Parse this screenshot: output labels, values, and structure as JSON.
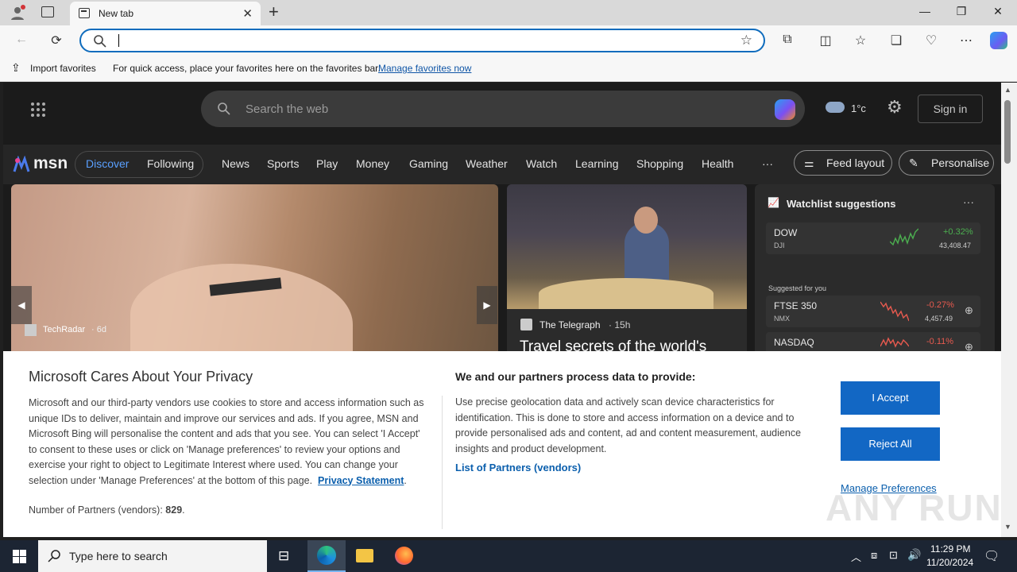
{
  "browser": {
    "tab_title": "New tab",
    "close_tab_glyph": "✕",
    "new_tab_glyph": "+",
    "window_controls": [
      "—",
      "❐",
      "✕"
    ],
    "address_value": "",
    "favorites_bar": {
      "import_label": "Import favorites",
      "message": "For quick access, place your favorites here on the favorites bar.",
      "link": "Manage favorites now"
    }
  },
  "msn": {
    "search_placeholder": "Search the web",
    "weather_temp": "1°c",
    "signin": "Sign in",
    "logo": "msn",
    "nav": [
      "Discover",
      "Following",
      "News",
      "Sports",
      "Play",
      "Money",
      "Gaming",
      "Weather",
      "Watch",
      "Learning",
      "Shopping",
      "Health",
      "···"
    ],
    "feed_layout": "Feed layout",
    "personalise": "Personalise",
    "hero": {
      "source": "TechRadar",
      "age": "6d"
    },
    "telegraph": {
      "source": "The Telegraph",
      "age": "15h",
      "headline": "Travel secrets of the world's"
    },
    "watchlist": {
      "title": "Watchlist suggestions",
      "more": "···",
      "suggested": "Suggested for you",
      "stocks": [
        {
          "symbol": "DOW",
          "exchange": "DJI",
          "change": "+0.32%",
          "value": "43,408.47",
          "color": "#4caf50"
        },
        {
          "symbol": "FTSE 350",
          "exchange": "NMX",
          "change": "-0.27%",
          "value": "4,457.49",
          "color": "#e85a4f"
        },
        {
          "symbol": "NASDAQ",
          "exchange": "",
          "change": "-0.11%",
          "value": "",
          "color": "#e85a4f"
        }
      ]
    }
  },
  "privacy": {
    "title": "Microsoft Cares About Your Privacy",
    "body": "Microsoft and our third-party vendors use cookies to store and access information such as unique IDs to deliver, maintain and improve our services and ads. If you agree, MSN and Microsoft Bing will personalise the content and ads that you see. You can select 'I Accept' to consent to these uses or click on 'Manage preferences' to review your options and exercise your right to object to Legitimate Interest where used.  You can change your selection under 'Manage Preferences' at the bottom of this page.",
    "privacy_link": "Privacy Statement",
    "count_label": "Number of Partners (vendors): ",
    "count_value": "829",
    "heading2": "We and our partners process data to provide:",
    "body2": "Use precise geolocation data and actively scan device characteristics for identification. This is done to store and access information on a device and to provide personalised ads and content, ad and content measurement, audience insights and product development.",
    "partners_link": "List of Partners (vendors)",
    "accept": "I Accept",
    "reject": "Reject All",
    "manage": "Manage Preferences"
  },
  "taskbar": {
    "search_placeholder": "Type here to search",
    "time": "11:29 PM",
    "date": "11/20/2024"
  },
  "watermark": "ANY RUN"
}
